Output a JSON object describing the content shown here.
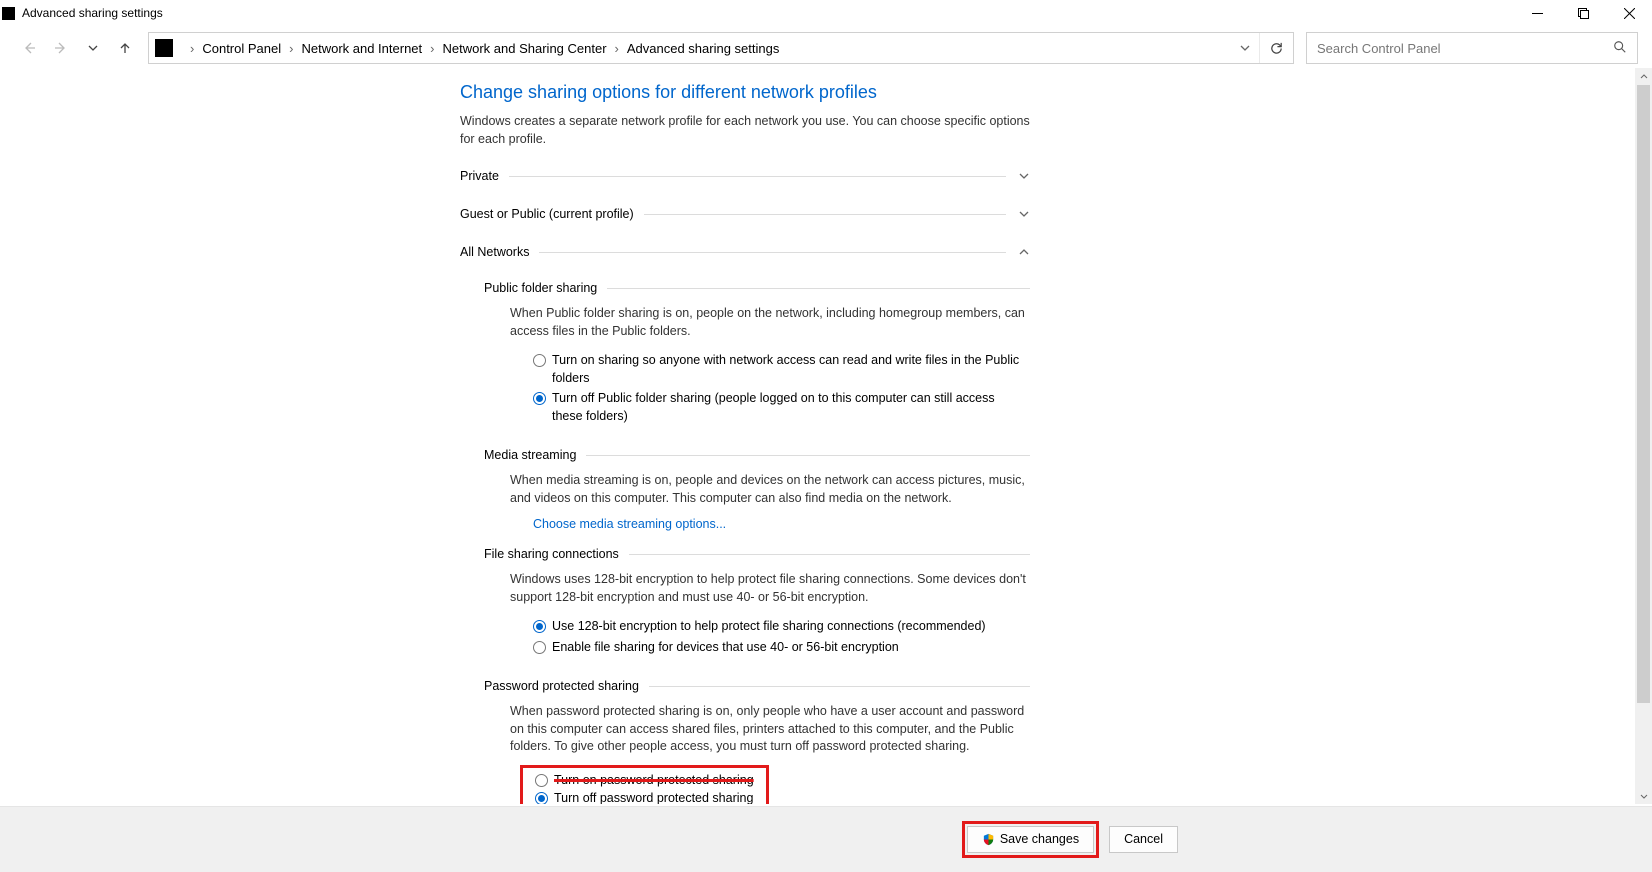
{
  "window": {
    "title": "Advanced sharing settings"
  },
  "breadcrumb": {
    "items": [
      "Control Panel",
      "Network and Internet",
      "Network and Sharing Center",
      "Advanced sharing settings"
    ]
  },
  "search": {
    "placeholder": "Search Control Panel"
  },
  "page": {
    "heading": "Change sharing options for different network profiles",
    "description": "Windows creates a separate network profile for each network you use. You can choose specific options for each profile."
  },
  "profiles": {
    "private": "Private",
    "guest": "Guest or Public (current profile)",
    "all": "All Networks"
  },
  "sections": {
    "publicFolder": {
      "title": "Public folder sharing",
      "desc": "When Public folder sharing is on, people on the network, including homegroup members, can access files in the Public folders.",
      "opt1": "Turn on sharing so anyone with network access can read and write files in the Public folders",
      "opt2": "Turn off Public folder sharing (people logged on to this computer can still access these folders)",
      "selected": "opt2"
    },
    "media": {
      "title": "Media streaming",
      "desc": "When media streaming is on, people and devices on the network can access pictures, music, and videos on this computer. This computer can also find media on the network.",
      "link": "Choose media streaming options..."
    },
    "fileSharing": {
      "title": "File sharing connections",
      "desc": "Windows uses 128-bit encryption to help protect file sharing connections. Some devices don't support 128-bit encryption and must use 40- or 56-bit encryption.",
      "opt1": "Use 128-bit encryption to help protect file sharing connections (recommended)",
      "opt2": "Enable file sharing for devices that use 40- or 56-bit encryption",
      "selected": "opt1"
    },
    "password": {
      "title": "Password protected sharing",
      "desc": "When password protected sharing is on, only people who have a user account and password on this computer can access shared files, printers attached to this computer, and the Public folders. To give other people access, you must turn off password protected sharing.",
      "opt1": "Turn on password protected sharing",
      "opt2": "Turn off password protected sharing",
      "selected": "opt2"
    }
  },
  "footer": {
    "save": "Save changes",
    "cancel": "Cancel"
  }
}
